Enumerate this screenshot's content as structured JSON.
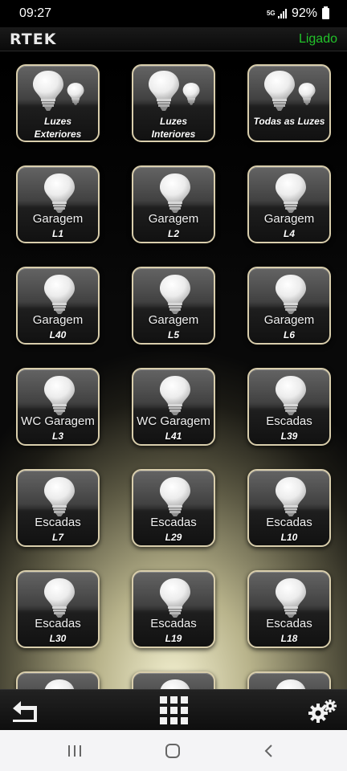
{
  "status_bar": {
    "time": "09:27",
    "network": "5G",
    "battery": "92%"
  },
  "header": {
    "logo": "RTEK",
    "connection_status": "Ligado",
    "connection_color": "#22c32a"
  },
  "groups": [
    {
      "line1": "Luzes",
      "line2": "Exteriores"
    },
    {
      "line1": "Luzes",
      "line2": "Interiores"
    },
    {
      "line1": "",
      "line2": "Todas as Luzes"
    }
  ],
  "lights": [
    {
      "name": "Garagem",
      "code": "L1"
    },
    {
      "name": "Garagem",
      "code": "L2"
    },
    {
      "name": "Garagem",
      "code": "L4"
    },
    {
      "name": "Garagem",
      "code": "L40"
    },
    {
      "name": "Garagem",
      "code": "L5"
    },
    {
      "name": "Garagem",
      "code": "L6"
    },
    {
      "name": "WC Garagem",
      "code": "L3"
    },
    {
      "name": "WC Garagem",
      "code": "L41"
    },
    {
      "name": "Escadas",
      "code": "L39"
    },
    {
      "name": "Escadas",
      "code": "L7"
    },
    {
      "name": "Escadas",
      "code": "L29"
    },
    {
      "name": "Escadas",
      "code": "L10"
    },
    {
      "name": "Escadas",
      "code": "L30"
    },
    {
      "name": "Escadas",
      "code": "L19"
    },
    {
      "name": "Escadas",
      "code": "L18"
    }
  ],
  "bottom_bar": {
    "back_icon": "back-arrow-icon",
    "menu_icon": "grid-menu-icon",
    "settings_icon": "gears-icon"
  },
  "nav_bar": {
    "recents_icon": "recents-icon",
    "home_icon": "home-icon",
    "back_icon": "nav-back-icon"
  }
}
